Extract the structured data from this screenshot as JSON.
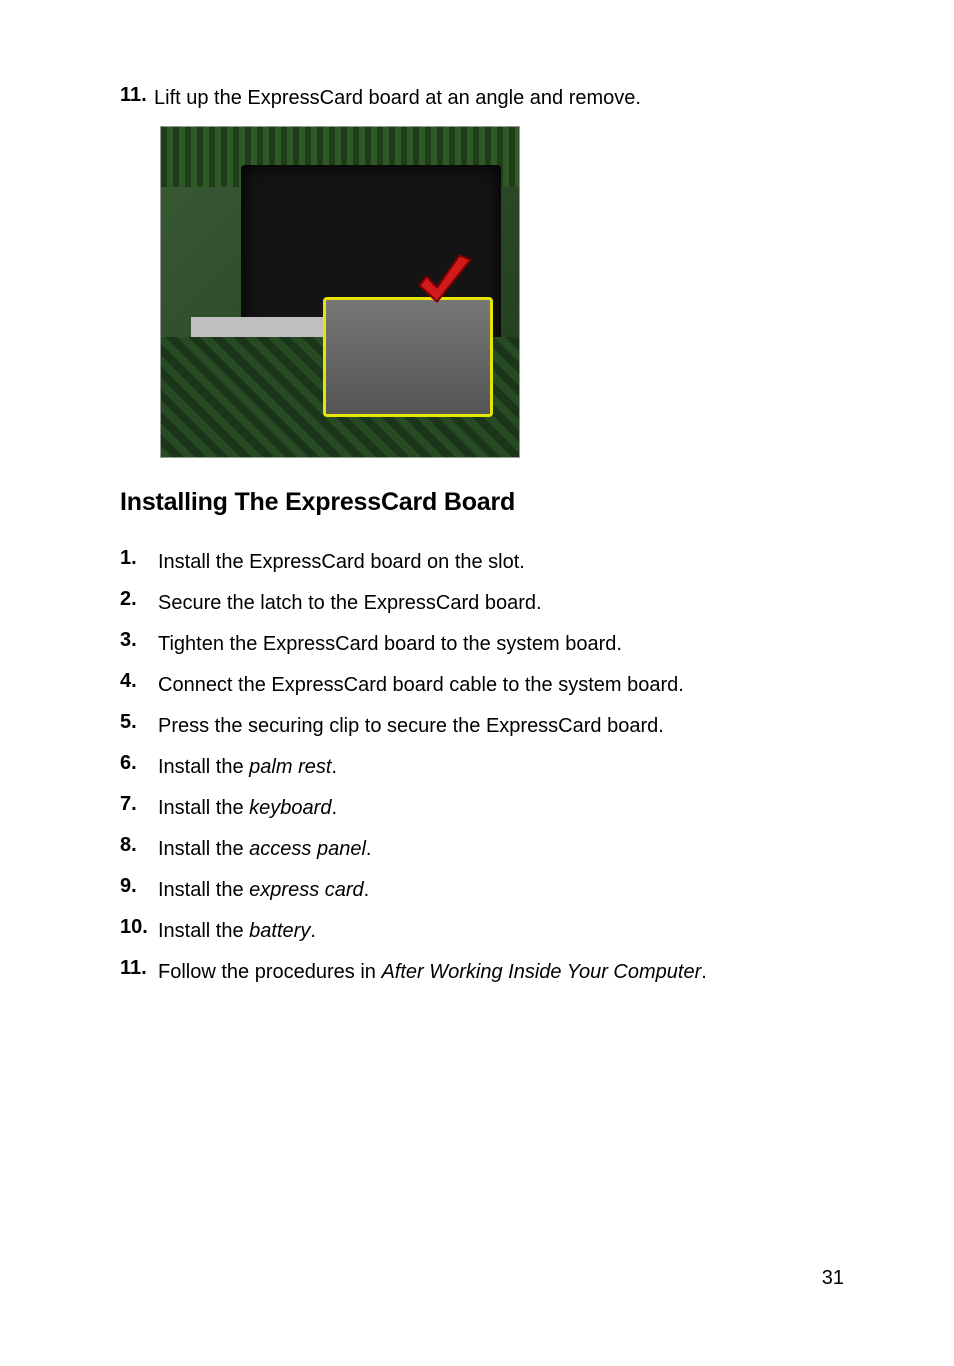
{
  "top": {
    "num": "11.",
    "text": "Lift up the ExpressCard board at an angle and remove."
  },
  "heading": "Installing The ExpressCard Board",
  "steps": {
    "s1": {
      "num": "1.",
      "text": "Install the ExpressCard board on the slot."
    },
    "s2": {
      "num": "2.",
      "text": "Secure the latch to the ExpressCard board."
    },
    "s3": {
      "num": "3.",
      "text": "Tighten the ExpressCard board to the system board."
    },
    "s4": {
      "num": "4.",
      "text": "Connect the ExpressCard board cable to the system board."
    },
    "s5": {
      "num": "5.",
      "text": "Press the securing clip to secure the ExpressCard board."
    },
    "s6": {
      "num": "6.",
      "pre": "Install the ",
      "em": "palm rest",
      "post": "."
    },
    "s7": {
      "num": "7.",
      "pre": "Install the ",
      "em": "keyboard",
      "post": "."
    },
    "s8": {
      "num": "8.",
      "pre": "Install the ",
      "em": "access panel",
      "post": "."
    },
    "s9": {
      "num": "9.",
      "pre": "Install the ",
      "em": "express card",
      "post": "."
    },
    "s10": {
      "num": "10.",
      "pre": "Install the ",
      "em": "battery",
      "post": "."
    },
    "s11": {
      "num": "11.",
      "pre": "Follow the procedures in ",
      "em": "After Working Inside Your Computer",
      "post": "."
    }
  },
  "pageNumber": "31"
}
